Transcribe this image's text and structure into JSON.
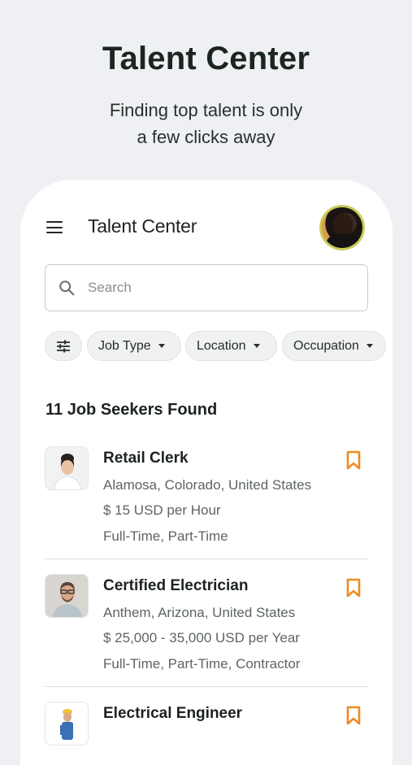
{
  "hero": {
    "title": "Talent Center",
    "subtitle_line1": "Finding top talent is only",
    "subtitle_line2": "a few clicks away"
  },
  "appbar": {
    "menu_icon": "hamburger-menu-icon",
    "title": "Talent Center",
    "avatar_ring_color": "#c9cc58"
  },
  "search": {
    "placeholder": "Search",
    "value": ""
  },
  "filters": {
    "filter_icon": "sliders-icon",
    "chips": [
      {
        "label": "Job Type"
      },
      {
        "label": "Location"
      },
      {
        "label": "Occupation"
      }
    ]
  },
  "results": {
    "count_label": "11 Job Seekers Found",
    "bookmark_color": "#f08a22",
    "items": [
      {
        "title": "Retail Clerk",
        "location": "Alamosa, Colorado, United States",
        "pay": "$ 15 USD per Hour",
        "type": "Full-Time, Part-Time"
      },
      {
        "title": "Certified Electrician",
        "location": "Anthem, Arizona, United States",
        "pay": "$ 25,000 - 35,000 USD per Year",
        "type": "Full-Time, Part-Time, Contractor"
      },
      {
        "title": "Electrical Engineer"
      }
    ]
  }
}
